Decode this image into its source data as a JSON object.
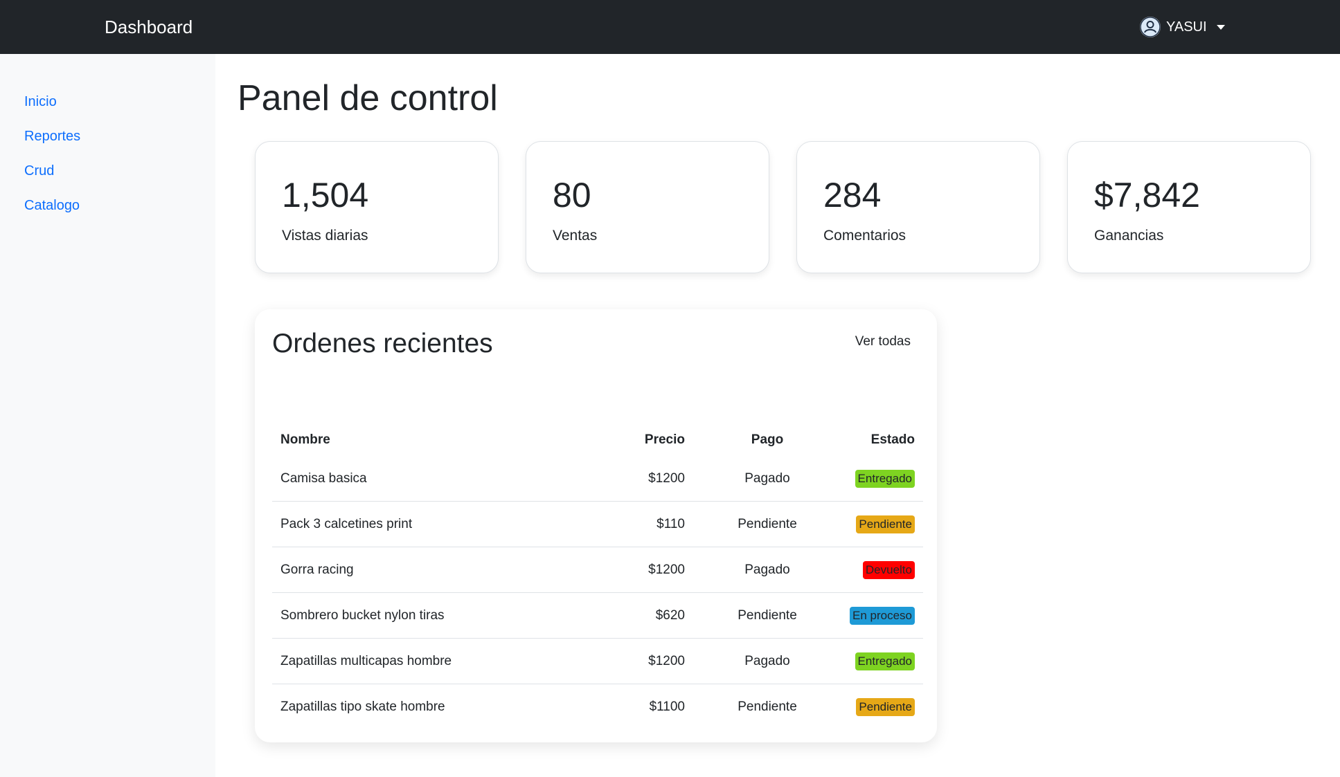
{
  "header": {
    "brand": "Dashboard",
    "user": "YASUI"
  },
  "sidebar": {
    "items": [
      {
        "label": "Inicio"
      },
      {
        "label": "Reportes"
      },
      {
        "label": "Crud"
      },
      {
        "label": "Catalogo"
      }
    ]
  },
  "main": {
    "title": "Panel de control",
    "stats": [
      {
        "value": "1,504",
        "label": "Vistas diarias"
      },
      {
        "value": "80",
        "label": "Ventas"
      },
      {
        "value": "284",
        "label": "Comentarios"
      },
      {
        "value": "$7,842",
        "label": "Ganancias"
      }
    ],
    "orders": {
      "title": "Ordenes recientes",
      "view_all": "Ver todas",
      "columns": {
        "name": "Nombre",
        "price": "Precio",
        "payment": "Pago",
        "status": "Estado"
      },
      "rows": [
        {
          "name": "Camisa basica",
          "price": "$1200",
          "payment": "Pagado",
          "status": "Entregado",
          "status_color": "#7ed321"
        },
        {
          "name": "Pack 3 calcetines print",
          "price": "$110",
          "payment": "Pendiente",
          "status": "Pendiente",
          "status_color": "#e6a817"
        },
        {
          "name": "Gorra racing",
          "price": "$1200",
          "payment": "Pagado",
          "status": "Devuelto",
          "status_color": "#ff0000"
        },
        {
          "name": "Sombrero bucket nylon tiras",
          "price": "$620",
          "payment": "Pendiente",
          "status": "En proceso",
          "status_color": "#1e9ad6"
        },
        {
          "name": "Zapatillas multicapas hombre",
          "price": "$1200",
          "payment": "Pagado",
          "status": "Entregado",
          "status_color": "#7ed321"
        },
        {
          "name": "Zapatillas tipo skate hombre",
          "price": "$1100",
          "payment": "Pendiente",
          "status": "Pendiente",
          "status_color": "#e6a817"
        }
      ]
    }
  },
  "icons": {
    "avatar": "user-circle-icon",
    "dropdown": "caret-down-icon"
  }
}
